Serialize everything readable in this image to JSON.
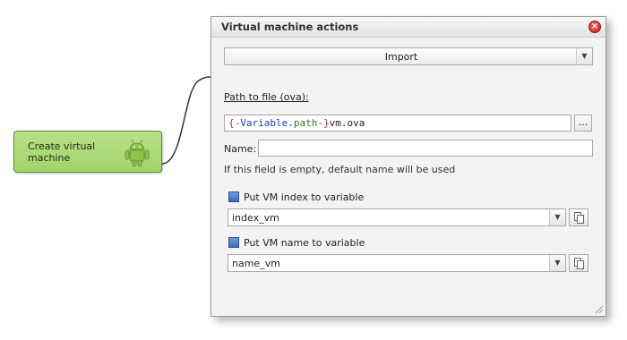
{
  "canvas": {
    "node": {
      "label": "Create virtual machine",
      "icon": "android-icon",
      "color": "#a3d46b"
    }
  },
  "dialog": {
    "title": "Virtual machine actions",
    "close_icon": "close-icon",
    "action": {
      "selected": "Import"
    },
    "path": {
      "label": "Path to file (ova):",
      "value": "{-Variable.path-}vm.ova",
      "tokens": {
        "open": "{-",
        "var": "Variable",
        "dot": ".",
        "name": "path",
        "close": "-}",
        "rest": "vm.ova"
      },
      "browse_label": "..."
    },
    "name": {
      "label": "Name:",
      "value": "",
      "hint": "If this field is empty, default name will be used"
    },
    "index_var": {
      "label": "Put VM index to variable",
      "value": "index_vm"
    },
    "name_var": {
      "label": "Put VM name to variable",
      "value": "name_vm"
    }
  }
}
